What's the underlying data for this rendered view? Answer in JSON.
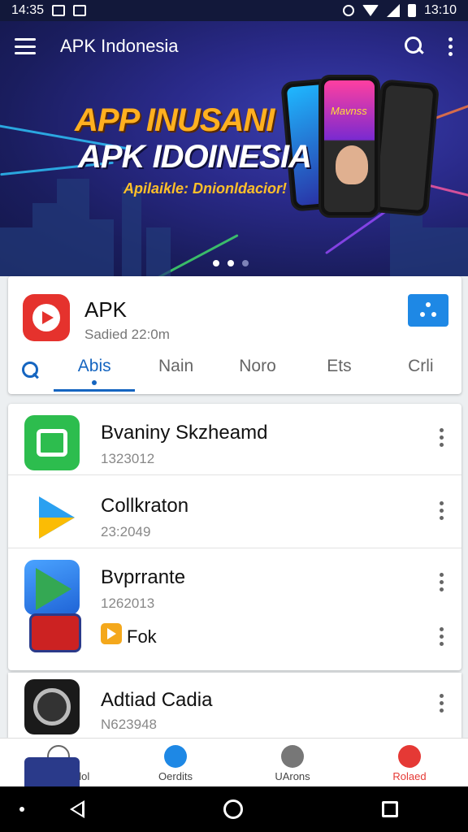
{
  "status_bar": {
    "time_left": "14:35",
    "time_right": "13:10"
  },
  "app_bar": {
    "title": "APK Indonesia"
  },
  "banner": {
    "headline_1": "APP INUSANI",
    "headline_2": "APK IDOINESIA",
    "headline_3": "Apilaikle: Dnionldacior!",
    "phone_text": "Mavnss",
    "carousel_count": 3,
    "carousel_active": 1
  },
  "app_info": {
    "name": "APK",
    "subtitle": "Sadied 22:0m",
    "colors": {
      "logo": "#e5322d",
      "share_button": "#1e88e5"
    }
  },
  "tabs": [
    {
      "label": "Abis",
      "active": true
    },
    {
      "label": "Nain",
      "active": false
    },
    {
      "label": "Noro",
      "active": false
    },
    {
      "label": "Ets",
      "active": false
    },
    {
      "label": "Crli",
      "active": false
    }
  ],
  "apps": [
    {
      "title": "Bvaniny Skzheamd",
      "sub": "1323012",
      "icon": "green-box-icon"
    },
    {
      "title": "Collkraton",
      "sub": "23:2049",
      "icon": "play-triangle-icon"
    },
    {
      "title": "Bvprrante",
      "sub": "1262013",
      "icon": "blue-play-icon"
    },
    {
      "title": "Fok",
      "sub": "",
      "icon": "promo-icon"
    },
    {
      "title": "Adtiad Cadia",
      "sub": "N623948",
      "icon": "speaker-icon"
    }
  ],
  "bottom_nav": [
    {
      "label": "Coonnean lol",
      "icon": "compass-icon",
      "color": "#666666"
    },
    {
      "label": "Oerdits",
      "icon": "play-circle-icon",
      "color": "#1e88e5"
    },
    {
      "label": "UArons",
      "icon": "chat-icon",
      "color": "#777777"
    },
    {
      "label": "Rolaed",
      "icon": "heart-chat-icon",
      "color": "#e53935"
    }
  ]
}
